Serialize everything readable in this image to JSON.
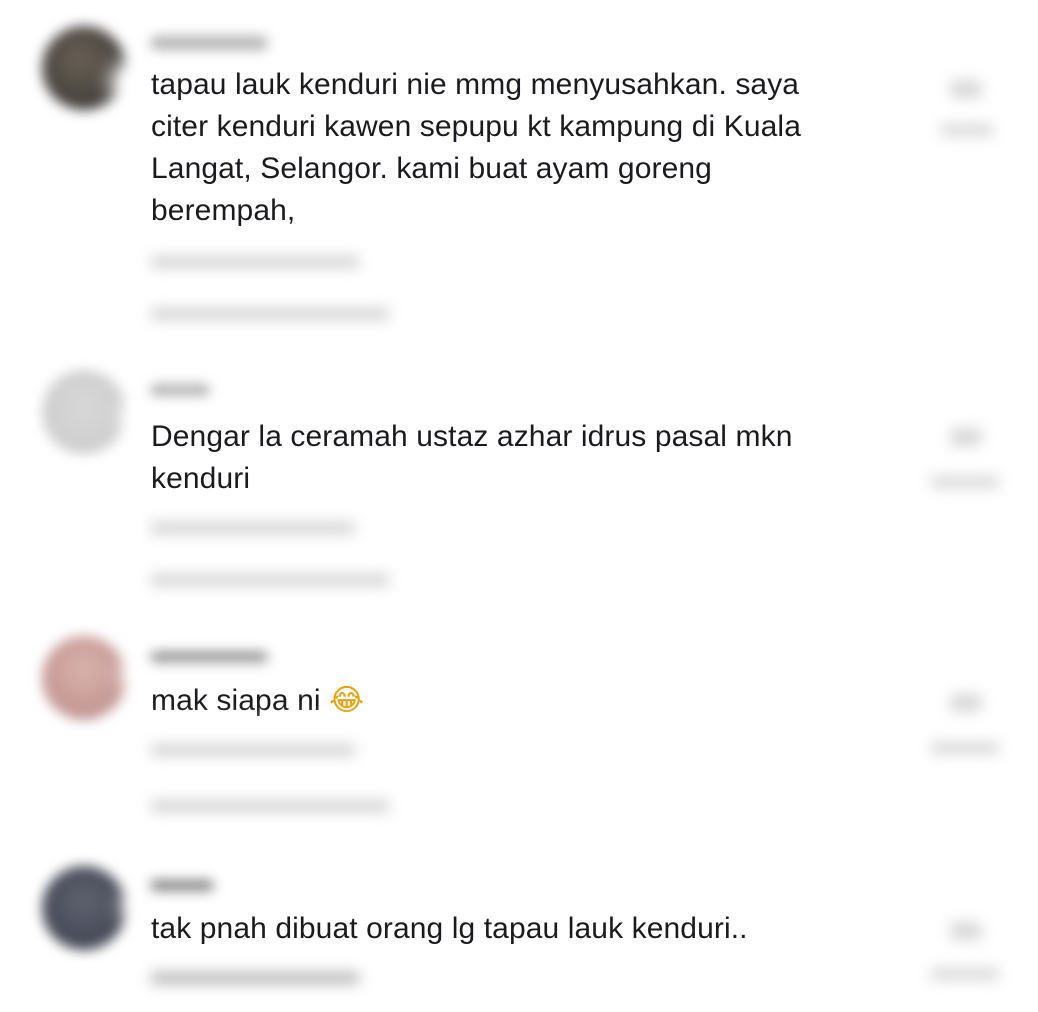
{
  "comments": [
    {
      "text_lines": [
        "tapau lauk kenduri nie mmg menyusahkan. saya",
        "citer kenduri kawen sepupu kt kampung di Kuala",
        "Langat, Selangor. kami buat ayam goreng",
        "berempah,"
      ]
    },
    {
      "text_lines": [
        "Dengar la ceramah ustaz azhar idrus pasal mkn",
        "kenduri"
      ]
    },
    {
      "text_lines": [
        "mak siapa ni"
      ],
      "emoji": "😂"
    },
    {
      "text_lines": [
        "tak pnah dibuat orang lg tapau lauk kenduri.."
      ]
    }
  ],
  "icons": [
    "avatar",
    "like-heart-icon"
  ]
}
